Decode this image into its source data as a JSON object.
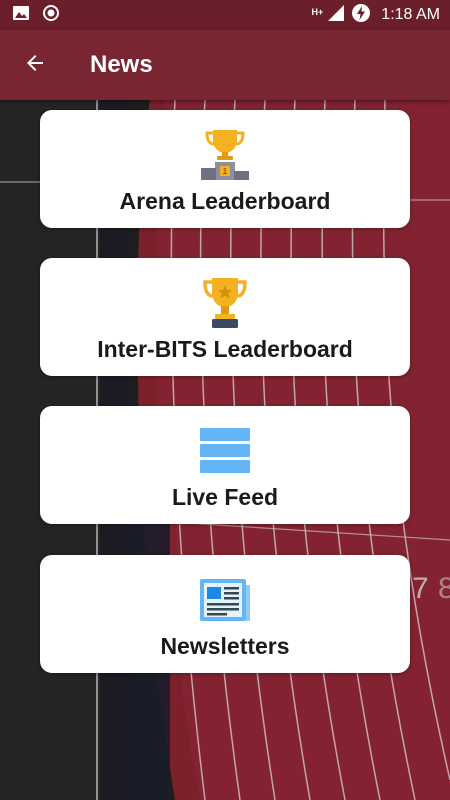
{
  "status_bar": {
    "time": "1:18 AM",
    "network": "H+",
    "icons": [
      "image-icon",
      "record-icon",
      "signal-icon",
      "battery-charging-icon"
    ]
  },
  "app_bar": {
    "title": "News",
    "back_icon": "arrow-back-icon"
  },
  "cards": [
    {
      "label": "Arena Leaderboard",
      "icon": "podium-trophy-icon"
    },
    {
      "label": "Inter-BITS Leaderboard",
      "icon": "trophy-cup-icon"
    },
    {
      "label": "Live Feed",
      "icon": "list-stack-icon"
    },
    {
      "label": "Newsletters",
      "icon": "newspaper-icon"
    }
  ],
  "colors": {
    "status_bar": "#6a1f2b",
    "app_bar": "#7a2532",
    "card": "#ffffff",
    "track": "#8e2533",
    "gold": "#f4b223",
    "blue": "#64b5f6"
  }
}
